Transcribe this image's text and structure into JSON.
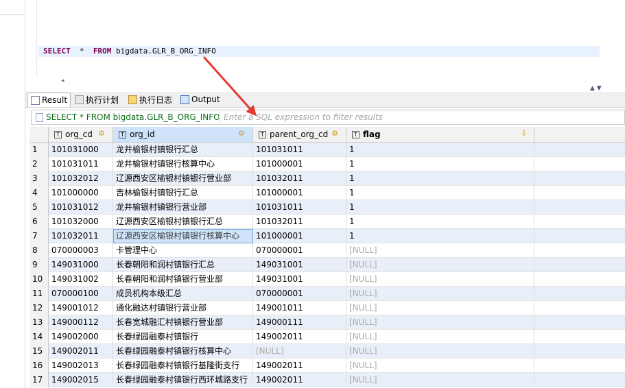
{
  "editor": {
    "sql_keyword_select": "SELECT",
    "sql_star": "*",
    "sql_keyword_from": "FROM",
    "sql_table": "bigdata.GLR_B_ORG_INFO"
  },
  "tabs": [
    {
      "label": "Result",
      "icon": "result-grid-icon"
    },
    {
      "label": "执行计划",
      "icon": "execution-plan-icon"
    },
    {
      "label": "执行日志",
      "icon": "execution-log-icon"
    },
    {
      "label": "Output",
      "icon": "output-icon"
    }
  ],
  "filter": {
    "query": "SELECT * FROM bigdata.GLR_B_ORG_INFO",
    "placeholder": "Enter a SQL expression to filter results"
  },
  "table": {
    "columns": [
      {
        "name": "org_cd",
        "type_icon": "T"
      },
      {
        "name": "org_id",
        "type_icon": "T"
      },
      {
        "name": "parent_org_cd",
        "type_icon": "T"
      },
      {
        "name": "flag",
        "type_icon": "T"
      }
    ],
    "rows": [
      {
        "n": "1",
        "org_cd": "101031000",
        "org_id": "龙井榆银村镇银行汇总",
        "parent_org_cd": "101031011",
        "flag": "1"
      },
      {
        "n": "2",
        "org_cd": "101031011",
        "org_id": "龙井榆银村镇银行核算中心",
        "parent_org_cd": "101000001",
        "flag": "1"
      },
      {
        "n": "3",
        "org_cd": "101032012",
        "org_id": "辽源西安区榆银村镇银行营业部",
        "parent_org_cd": "101032011",
        "flag": "1"
      },
      {
        "n": "4",
        "org_cd": "101000000",
        "org_id": "吉林榆银村镇银行汇总",
        "parent_org_cd": "101000001",
        "flag": "1"
      },
      {
        "n": "5",
        "org_cd": "101031012",
        "org_id": "龙井榆银村镇银行营业部",
        "parent_org_cd": "101031011",
        "flag": "1"
      },
      {
        "n": "6",
        "org_cd": "101032000",
        "org_id": "辽源西安区榆银村镇银行汇总",
        "parent_org_cd": "101032011",
        "flag": "1"
      },
      {
        "n": "7",
        "org_cd": "101032011",
        "org_id": "辽源西安区榆银村镇银行核算中心",
        "parent_org_cd": "101000001",
        "flag": "1"
      },
      {
        "n": "8",
        "org_cd": "070000003",
        "org_id": "卡管理中心",
        "parent_org_cd": "070000001",
        "flag": "[NULL]"
      },
      {
        "n": "9",
        "org_cd": "149031000",
        "org_id": "长春朝阳和润村镇银行汇总",
        "parent_org_cd": "149031001",
        "flag": "[NULL]"
      },
      {
        "n": "10",
        "org_cd": "149031002",
        "org_id": "长春朝阳和润村镇银行营业部",
        "parent_org_cd": "149031001",
        "flag": "[NULL]"
      },
      {
        "n": "11",
        "org_cd": "070000100",
        "org_id": "成员机构本级汇总",
        "parent_org_cd": "070000001",
        "flag": "[NULL]"
      },
      {
        "n": "12",
        "org_cd": "149001012",
        "org_id": "通化融达村镇银行营业部",
        "parent_org_cd": "149001011",
        "flag": "[NULL]"
      },
      {
        "n": "13",
        "org_cd": "149000112",
        "org_id": "长春宽城融汇村镇银行营业部",
        "parent_org_cd": "149000111",
        "flag": "[NULL]"
      },
      {
        "n": "14",
        "org_cd": "149002000",
        "org_id": "长春绿园融泰村镇银行",
        "parent_org_cd": "149002011",
        "flag": "[NULL]"
      },
      {
        "n": "15",
        "org_cd": "149002011",
        "org_id": "长春绿园融泰村镇银行核算中心",
        "parent_org_cd": "[NULL]",
        "flag": "[NULL]"
      },
      {
        "n": "16",
        "org_cd": "149002013",
        "org_id": "长春绿园融泰村镇银行基隆街支行",
        "parent_org_cd": "149002011",
        "flag": "[NULL]"
      },
      {
        "n": "17",
        "org_cd": "149002015",
        "org_id": "长春绿园融泰村镇银行西环城路支行",
        "parent_org_cd": "149002011",
        "flag": "[NULL]"
      }
    ],
    "selected_row": 7,
    "selected_column": "org_id",
    "null_color": "#a9a9a9"
  },
  "annotation": {
    "arrow_color": "#e53a2f"
  }
}
